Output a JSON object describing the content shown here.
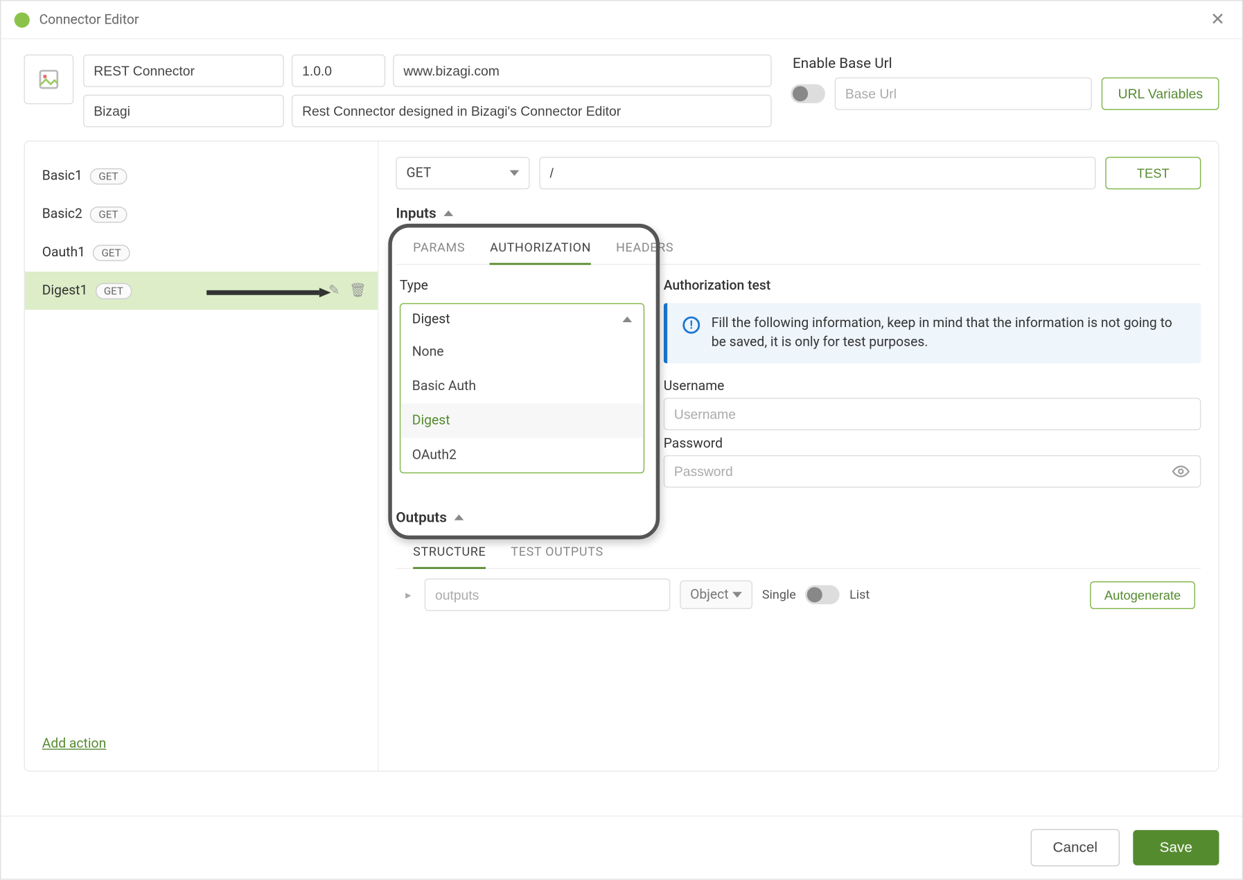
{
  "window": {
    "title": "Connector Editor"
  },
  "header": {
    "name": "REST Connector",
    "version": "1.0.0",
    "site": "www.bizagi.com",
    "vendor": "Bizagi",
    "description": "Rest Connector designed in Bizagi's Connector Editor",
    "enable_base_url_label": "Enable Base Url",
    "base_url_placeholder": "Base Url",
    "url_variables_label": "URL Variables"
  },
  "sidebar": {
    "actions": [
      {
        "name": "Basic1",
        "method": "GET",
        "active": false
      },
      {
        "name": "Basic2",
        "method": "GET",
        "active": false
      },
      {
        "name": "Oauth1",
        "method": "GET",
        "active": false
      },
      {
        "name": "Digest1",
        "method": "GET",
        "active": true
      }
    ],
    "add_action_label": "Add action"
  },
  "main": {
    "method": "GET",
    "path": "/",
    "test_label": "TEST",
    "inputs_label": "Inputs",
    "tabs": {
      "params": "PARAMS",
      "authorization": "AUTHORIZATION",
      "headers": "HEADERS"
    },
    "type_label": "Type",
    "type_dropdown": {
      "selected": "Digest",
      "options": [
        "None",
        "Basic Auth",
        "Digest",
        "OAuth2"
      ]
    },
    "auth_test": {
      "title": "Authorization test",
      "info": "Fill the following information, keep in mind that the information is not going to be saved, it is only for test purposes.",
      "username_label": "Username",
      "username_placeholder": "Username",
      "password_label": "Password",
      "password_placeholder": "Password"
    },
    "outputs_label": "Outputs",
    "output_tabs": {
      "structure": "STRUCTURE",
      "test_outputs": "TEST OUTPUTS"
    },
    "outputs_placeholder": "outputs",
    "output_type": "Object",
    "single_label": "Single",
    "list_label": "List",
    "autogen_label": "Autogenerate"
  },
  "footer": {
    "cancel": "Cancel",
    "save": "Save"
  }
}
